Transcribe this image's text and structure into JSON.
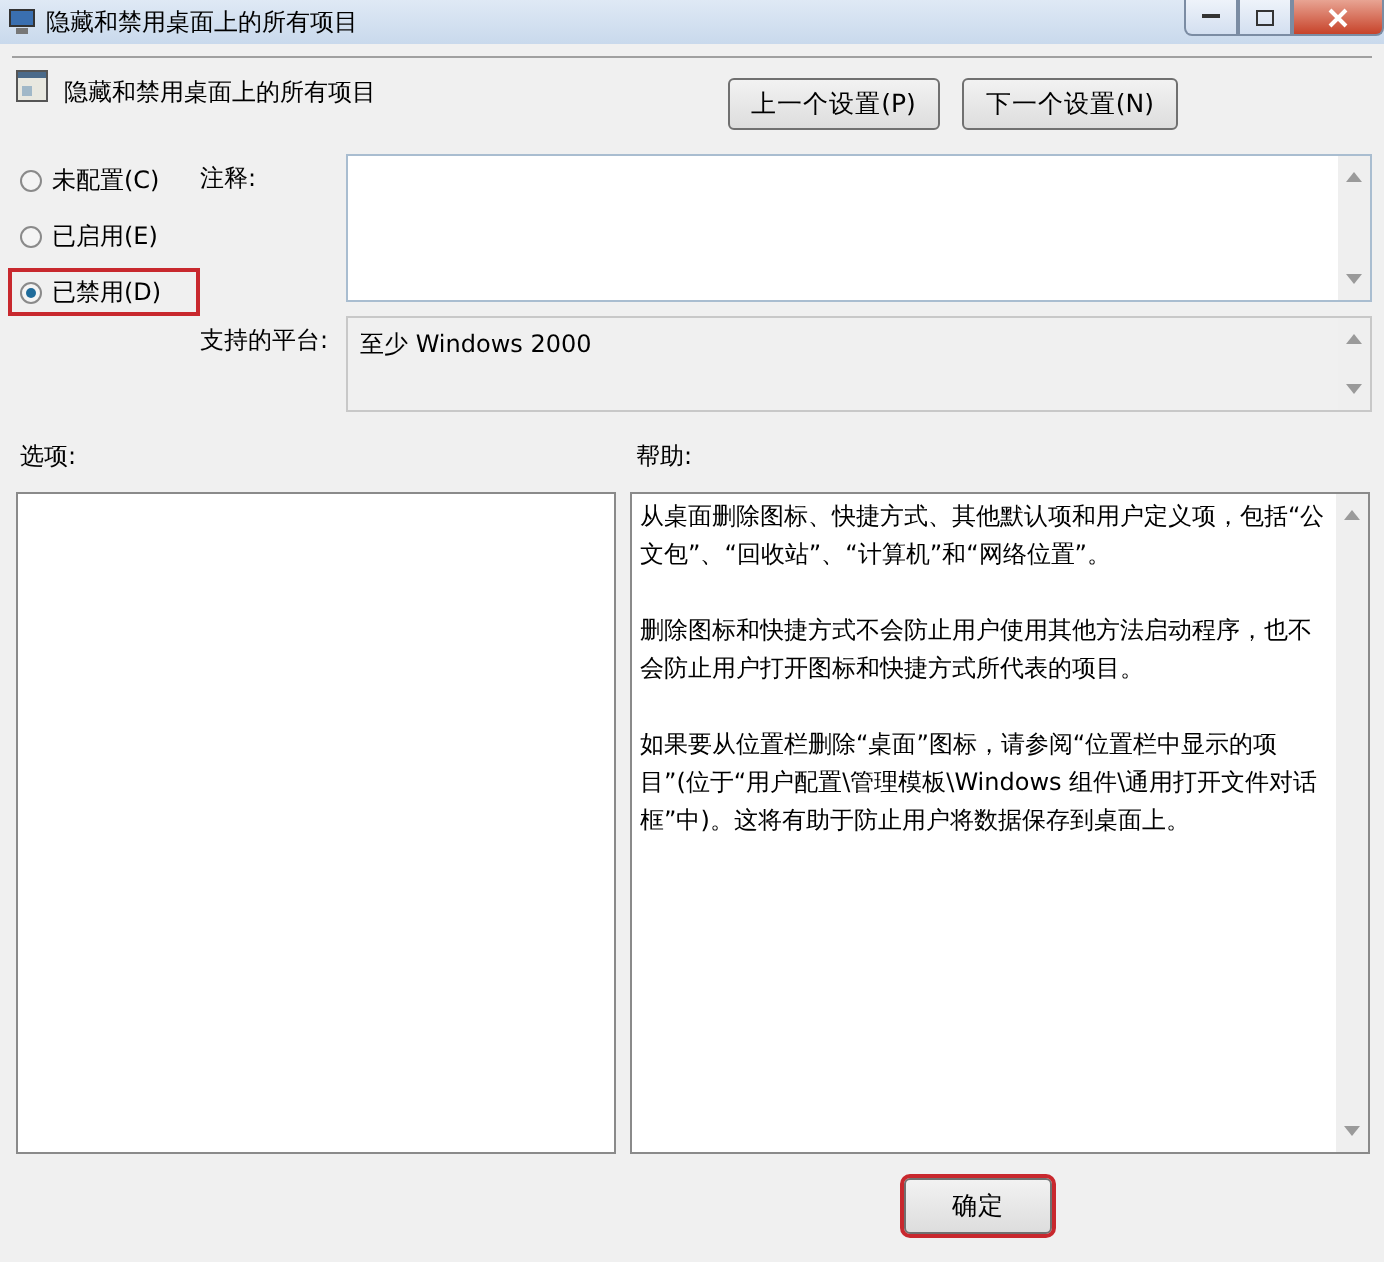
{
  "window": {
    "title": "隐藏和禁用桌面上的所有项目"
  },
  "policy": {
    "title": "隐藏和禁用桌面上的所有项目"
  },
  "nav_buttons": [
    {
      "label": "上一个设置(P)"
    },
    {
      "label": "下一个设置(N)"
    }
  ],
  "state_options": [
    {
      "label": "未配置(C)",
      "selected": false,
      "highlighted": false
    },
    {
      "label": "已启用(E)",
      "selected": false,
      "highlighted": false
    },
    {
      "label": "已禁用(D)",
      "selected": true,
      "highlighted": true
    }
  ],
  "comment": {
    "label": "注释:"
  },
  "platform": {
    "label": "支持的平台:",
    "value": "至少 Windows 2000"
  },
  "options": {
    "label": "选项:"
  },
  "help": {
    "label": "帮助:",
    "paragraphs": [
      "从桌面删除图标、快捷方式、其他默认项和用户定义项，包括“公文包”、“回收站”、“计算机”和“网络位置”。",
      "删除图标和快捷方式不会防止用户使用其他方法启动程序，也不会防止用户打开图标和快捷方式所代表的项目。",
      "如果要从位置栏删除“桌面”图标，请参阅“位置栏中显示的项目”(位于“用户配置\\管理模板\\Windows 组件\\通用打开文件对话框”中)。这将有助于防止用户将数据保存到桌面上。"
    ]
  },
  "buttons": [
    {
      "label": "确定",
      "highlighted": true
    }
  ]
}
